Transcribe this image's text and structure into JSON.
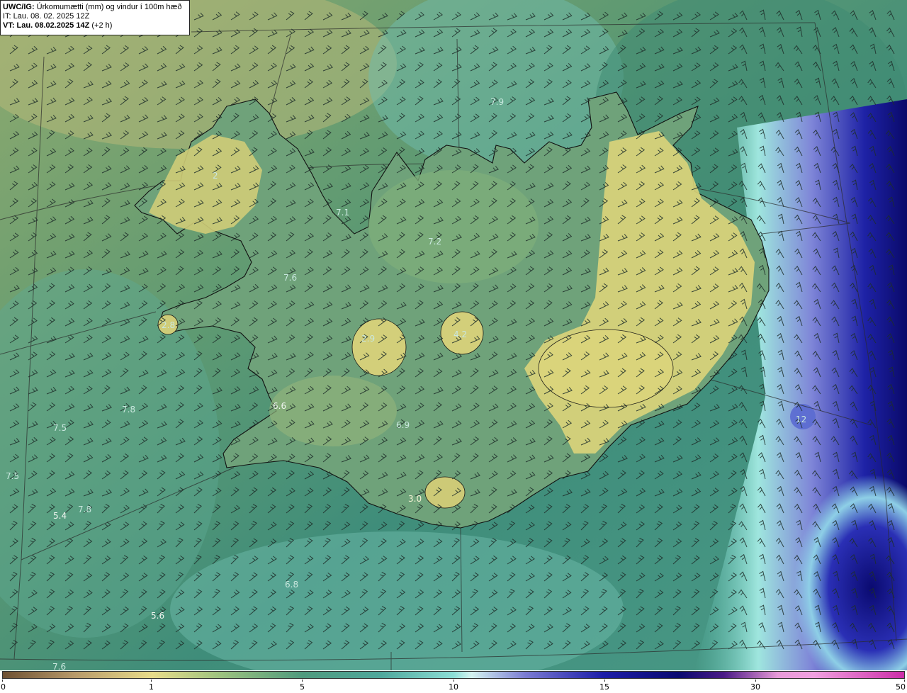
{
  "header": {
    "title_prefix": "UWC/IG:",
    "title_rest": " Úrkomumætti (mm) og vindur í 100m hæð",
    "it_line": "IT: Lau. 08. 02. 2025 12Z",
    "vt_prefix": "VT: Lau. 08.02.2025 14Z",
    "vt_suffix": " (+2 h)"
  },
  "colors": {
    "ocean_base": "#3d8a78",
    "land_dry": "#d8d27a",
    "moist_teal": "#4fa89c",
    "high_blue": "#1d1ea8",
    "deep_blue": "#0a0a70",
    "coastline": "#111111",
    "barb": "#1e2e2a"
  },
  "map_labels": [
    {
      "text": "7.9"
    },
    {
      "text": "7.1"
    },
    {
      "text": "7.2"
    },
    {
      "text": "7.6"
    },
    {
      "text": "2.8"
    },
    {
      "text": "2.9"
    },
    {
      "text": "4.2"
    },
    {
      "text": "6.6"
    },
    {
      "text": "6.9"
    },
    {
      "text": "7.8"
    },
    {
      "text": "7.5"
    },
    {
      "text": "7.5"
    },
    {
      "text": "7.8"
    },
    {
      "text": "5.4"
    },
    {
      "text": "3.0"
    },
    {
      "text": "6.8"
    },
    {
      "text": "5.6"
    },
    {
      "text": "7.6"
    },
    {
      "text": "12"
    },
    {
      "text": "2"
    }
  ],
  "colorbar": {
    "ticks": [
      "0",
      "1",
      "5",
      "10",
      "15",
      "30",
      "50"
    ]
  }
}
